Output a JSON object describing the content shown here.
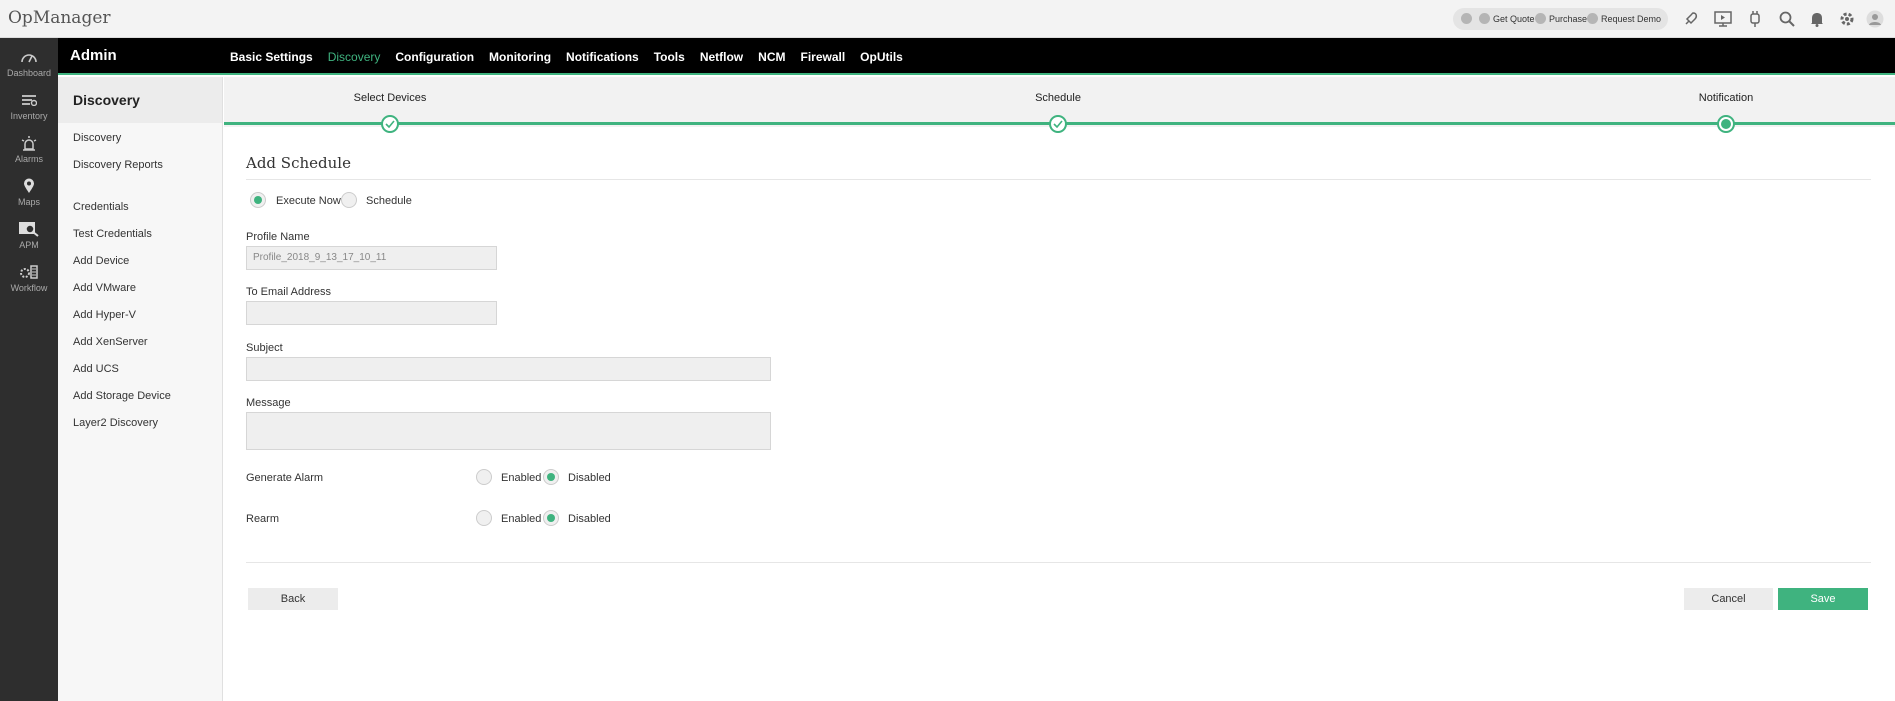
{
  "app": {
    "title": "OpManager"
  },
  "topbar": {
    "links": [
      "Get Quote",
      "Purchase",
      "Request Demo"
    ],
    "icons": [
      "rocket-icon",
      "screen-icon",
      "plug-icon",
      "search-icon",
      "bell-icon",
      "gear-icon",
      "user-icon"
    ]
  },
  "leftnav": {
    "items": [
      {
        "label": "Dashboard",
        "icon": "dashboard-icon"
      },
      {
        "label": "Inventory",
        "icon": "inventory-icon"
      },
      {
        "label": "Alarms",
        "icon": "alarm-icon"
      },
      {
        "label": "Maps",
        "icon": "map-pin-icon"
      },
      {
        "label": "APM",
        "icon": "apm-icon"
      },
      {
        "label": "Workflow",
        "icon": "workflow-icon"
      }
    ]
  },
  "header": {
    "section": "Admin",
    "menu": [
      "Basic Settings",
      "Discovery",
      "Configuration",
      "Monitoring",
      "Notifications",
      "Tools",
      "Netflow",
      "NCM",
      "Firewall",
      "OpUtils"
    ],
    "active_menu": "Discovery"
  },
  "sidemenu": {
    "title": "Discovery",
    "items": [
      "Discovery",
      "Discovery Reports",
      "Credentials",
      "Test Credentials",
      "Add Device",
      "Add VMware",
      "Add Hyper-V",
      "Add XenServer",
      "Add UCS",
      "Add Storage Device",
      "Layer2 Discovery"
    ]
  },
  "wizard": {
    "steps": [
      {
        "label": "Select Devices",
        "state": "done"
      },
      {
        "label": "Schedule",
        "state": "done"
      },
      {
        "label": "Notification",
        "state": "current"
      }
    ]
  },
  "form": {
    "title": "Add Schedule",
    "run_mode": {
      "options": [
        "Execute Now",
        "Schedule"
      ],
      "selected": "Execute Now"
    },
    "profile_name": {
      "label": "Profile Name",
      "value": "Profile_2018_9_13_17_10_11"
    },
    "to_email": {
      "label": "To Email Address",
      "value": ""
    },
    "subject": {
      "label": "Subject",
      "value": ""
    },
    "message": {
      "label": "Message",
      "value": ""
    },
    "generate_alarm": {
      "label": "Generate Alarm",
      "options": [
        "Enabled",
        "Disabled"
      ],
      "selected": "Disabled"
    },
    "rearm": {
      "label": "Rearm",
      "options": [
        "Enabled",
        "Disabled"
      ],
      "selected": "Disabled"
    },
    "back_label": "Back",
    "cancel_label": "Cancel",
    "save_label": "Save"
  },
  "colors": {
    "accent": "#3fb37f",
    "header_bg": "#000000",
    "nav_bg": "#2e2e2e"
  }
}
